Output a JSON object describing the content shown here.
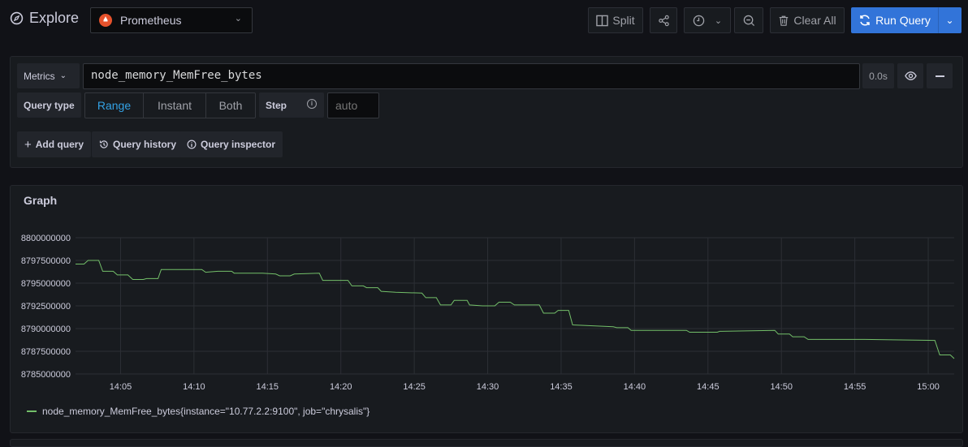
{
  "header": {
    "title": "Explore",
    "datasource": "Prometheus",
    "split_label": "Split",
    "clear_all_label": "Clear All",
    "run_query_label": "Run Query",
    "accent": "#3274d9"
  },
  "query": {
    "metrics_label": "Metrics",
    "expression": "node_memory_MemFree_bytes",
    "duration": "0.0s",
    "query_type_label": "Query type",
    "query_types": [
      "Range",
      "Instant",
      "Both"
    ],
    "selected_query_type": "Range",
    "step_label": "Step",
    "step_placeholder": "auto",
    "add_query_label": "Add query",
    "history_label": "Query history",
    "inspector_label": "Query inspector"
  },
  "graph": {
    "title": "Graph"
  },
  "chart_data": {
    "type": "line",
    "grid": true,
    "legend_placement": "bottom-left",
    "ylim": [
      8785000000,
      8800000000
    ],
    "yticks": [
      "8800000000",
      "8797500000",
      "8795000000",
      "8792500000",
      "8790000000",
      "8787500000",
      "8785000000"
    ],
    "xticks": [
      "14:05",
      "14:10",
      "14:15",
      "14:20",
      "14:25",
      "14:30",
      "14:35",
      "14:40",
      "14:45",
      "14:50",
      "14:55",
      "15:00"
    ],
    "xlim": [
      "14:01:56",
      "15:01:46"
    ],
    "series": [
      {
        "name": "node_memory_MemFree_bytes{instance=\"10.77.2.2:9100\", job=\"chrysalis\"}",
        "color": "#73bf69",
        "x": [
          "14:01:56",
          "14:02:31",
          "14:02:47",
          "14:03:31",
          "14:03:47",
          "14:04:30",
          "14:04:47",
          "14:05:30",
          "14:05:50",
          "14:06:33",
          "14:06:46",
          "14:07:33",
          "14:07:46",
          "14:10:32",
          "14:10:48",
          "14:11:38",
          "14:12:34",
          "14:12:44",
          "14:14:40",
          "14:15:34",
          "14:15:50",
          "14:16:33",
          "14:16:50",
          "14:18:32",
          "14:18:46",
          "14:20:29",
          "14:20:45",
          "14:21:32",
          "14:21:45",
          "14:22:31",
          "14:22:45",
          "14:23:44",
          "14:25:31",
          "14:25:47",
          "14:26:30",
          "14:26:47",
          "14:27:30",
          "14:27:43",
          "14:28:36",
          "14:28:46",
          "14:29:39",
          "14:30:29",
          "14:30:46",
          "14:31:32",
          "14:31:49",
          "14:33:31",
          "14:33:48",
          "14:34:34",
          "14:34:48",
          "14:35:31",
          "14:35:47",
          "14:38:33",
          "14:38:47",
          "14:39:33",
          "14:39:46",
          "14:41:39",
          "14:43:32",
          "14:43:45",
          "14:45:38",
          "14:45:48",
          "14:49:33",
          "14:49:47",
          "14:50:33",
          "14:50:46",
          "14:51:33",
          "14:51:49",
          "14:54:38",
          "14:55:41",
          "15:00:27",
          "15:00:47",
          "15:01:30",
          "15:01:46"
        ],
        "y": [
          8797100000,
          8797100000,
          8797500000,
          8797500000,
          8796300000,
          8796300000,
          8795900000,
          8795900000,
          8795400000,
          8795400000,
          8795500000,
          8795500000,
          8796500000,
          8796500000,
          8796200000,
          8796300000,
          8796300000,
          8796100000,
          8796100000,
          8796000000,
          8795800000,
          8795800000,
          8796000000,
          8796100000,
          8795300000,
          8795300000,
          8794700000,
          8794700000,
          8794500000,
          8794500000,
          8794100000,
          8794000000,
          8793900000,
          8793400000,
          8793400000,
          8792600000,
          8792600000,
          8793100000,
          8793100000,
          8792600000,
          8792500000,
          8792500000,
          8792900000,
          8792900000,
          8792600000,
          8792600000,
          8791700000,
          8791700000,
          8792000000,
          8792000000,
          8790400000,
          8790200000,
          8790100000,
          8790100000,
          8789800000,
          8789800000,
          8789800000,
          8789600000,
          8789600000,
          8789700000,
          8789800000,
          8789400000,
          8789400000,
          8789100000,
          8789100000,
          8788800000,
          8788800000,
          8788800000,
          8788700000,
          8787100000,
          8787100000,
          8786700000
        ]
      }
    ]
  }
}
